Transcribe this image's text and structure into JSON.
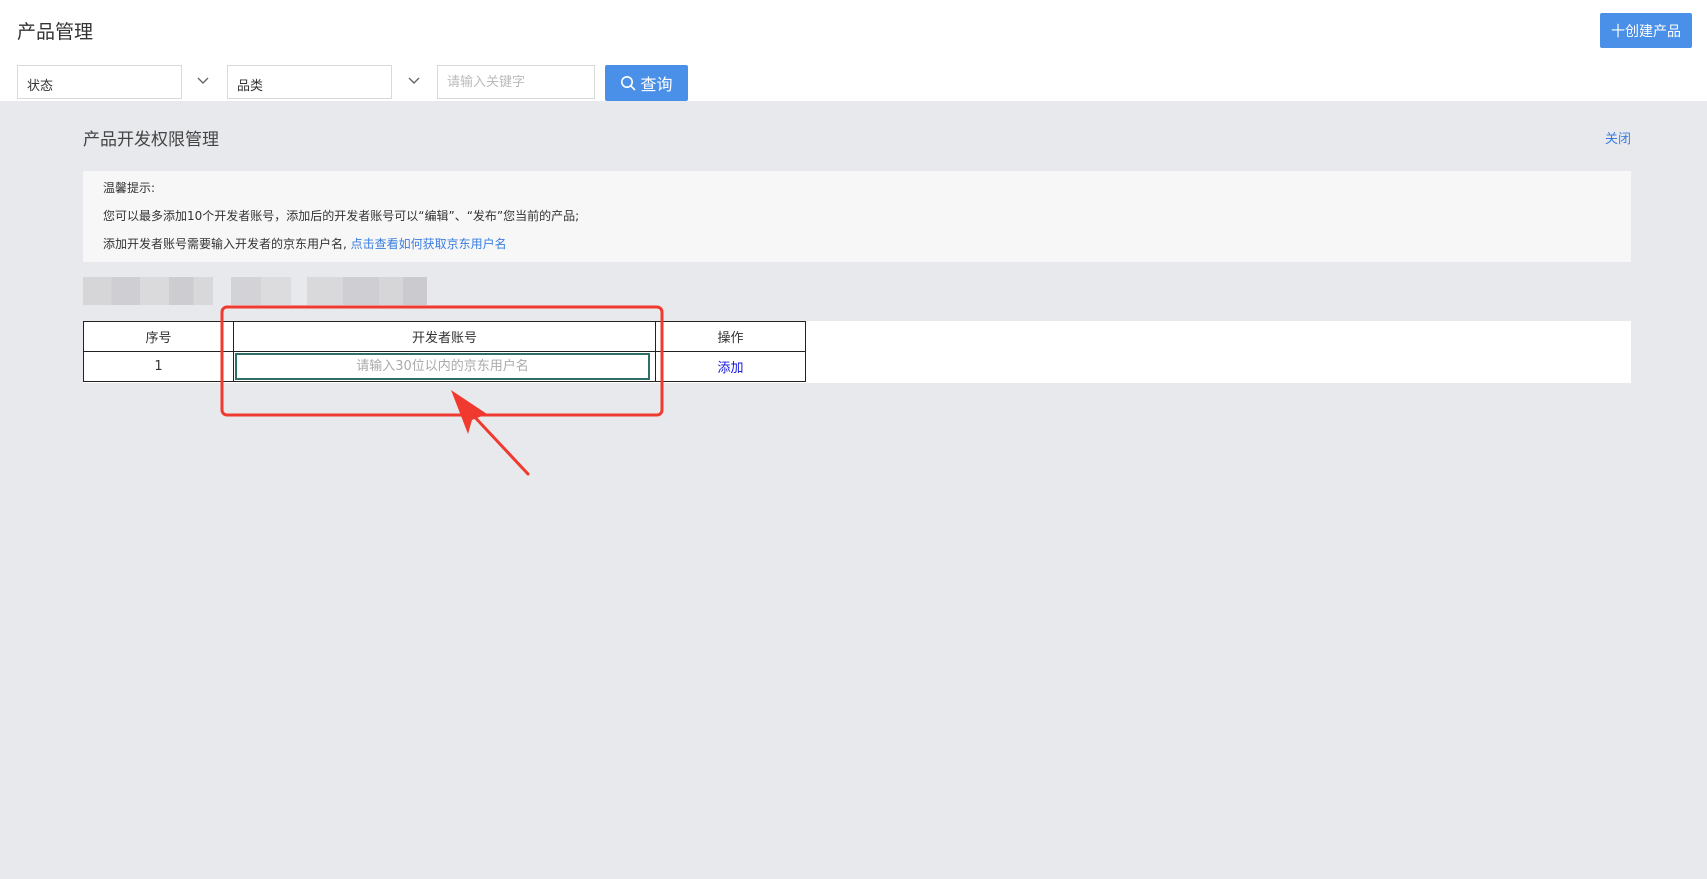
{
  "header": {
    "title": "产品管理",
    "create_button": "十创建产品"
  },
  "filters": {
    "status": {
      "value": "状态"
    },
    "category": {
      "value": "品类"
    },
    "keyword": {
      "placeholder": "请输入关键字"
    },
    "query_button": "查询"
  },
  "panel": {
    "title": "产品开发权限管理",
    "close_label": "关闭",
    "tips": {
      "heading": "温馨提示:",
      "line1": "您可以最多添加10个开发者账号，添加后的开发者账号可以“编辑”、“发布”您当前的产品;",
      "line2_prefix": "添加开发者账号需要输入开发者的京东用户名,",
      "line2_link": "点击查看如何获取京东用户名"
    },
    "table": {
      "columns": [
        "序号",
        "开发者账号",
        "操作"
      ],
      "rows": [
        {
          "index": "1",
          "account_placeholder": "请输入30位以内的京东用户名",
          "action": "添加"
        }
      ]
    }
  },
  "colors": {
    "primary_button": "#4a8fe8",
    "link": "#3a7de0",
    "panel_bg": "#e8e9ed",
    "annotation": "#f03a30",
    "input_focus_border": "#2e6f67"
  }
}
